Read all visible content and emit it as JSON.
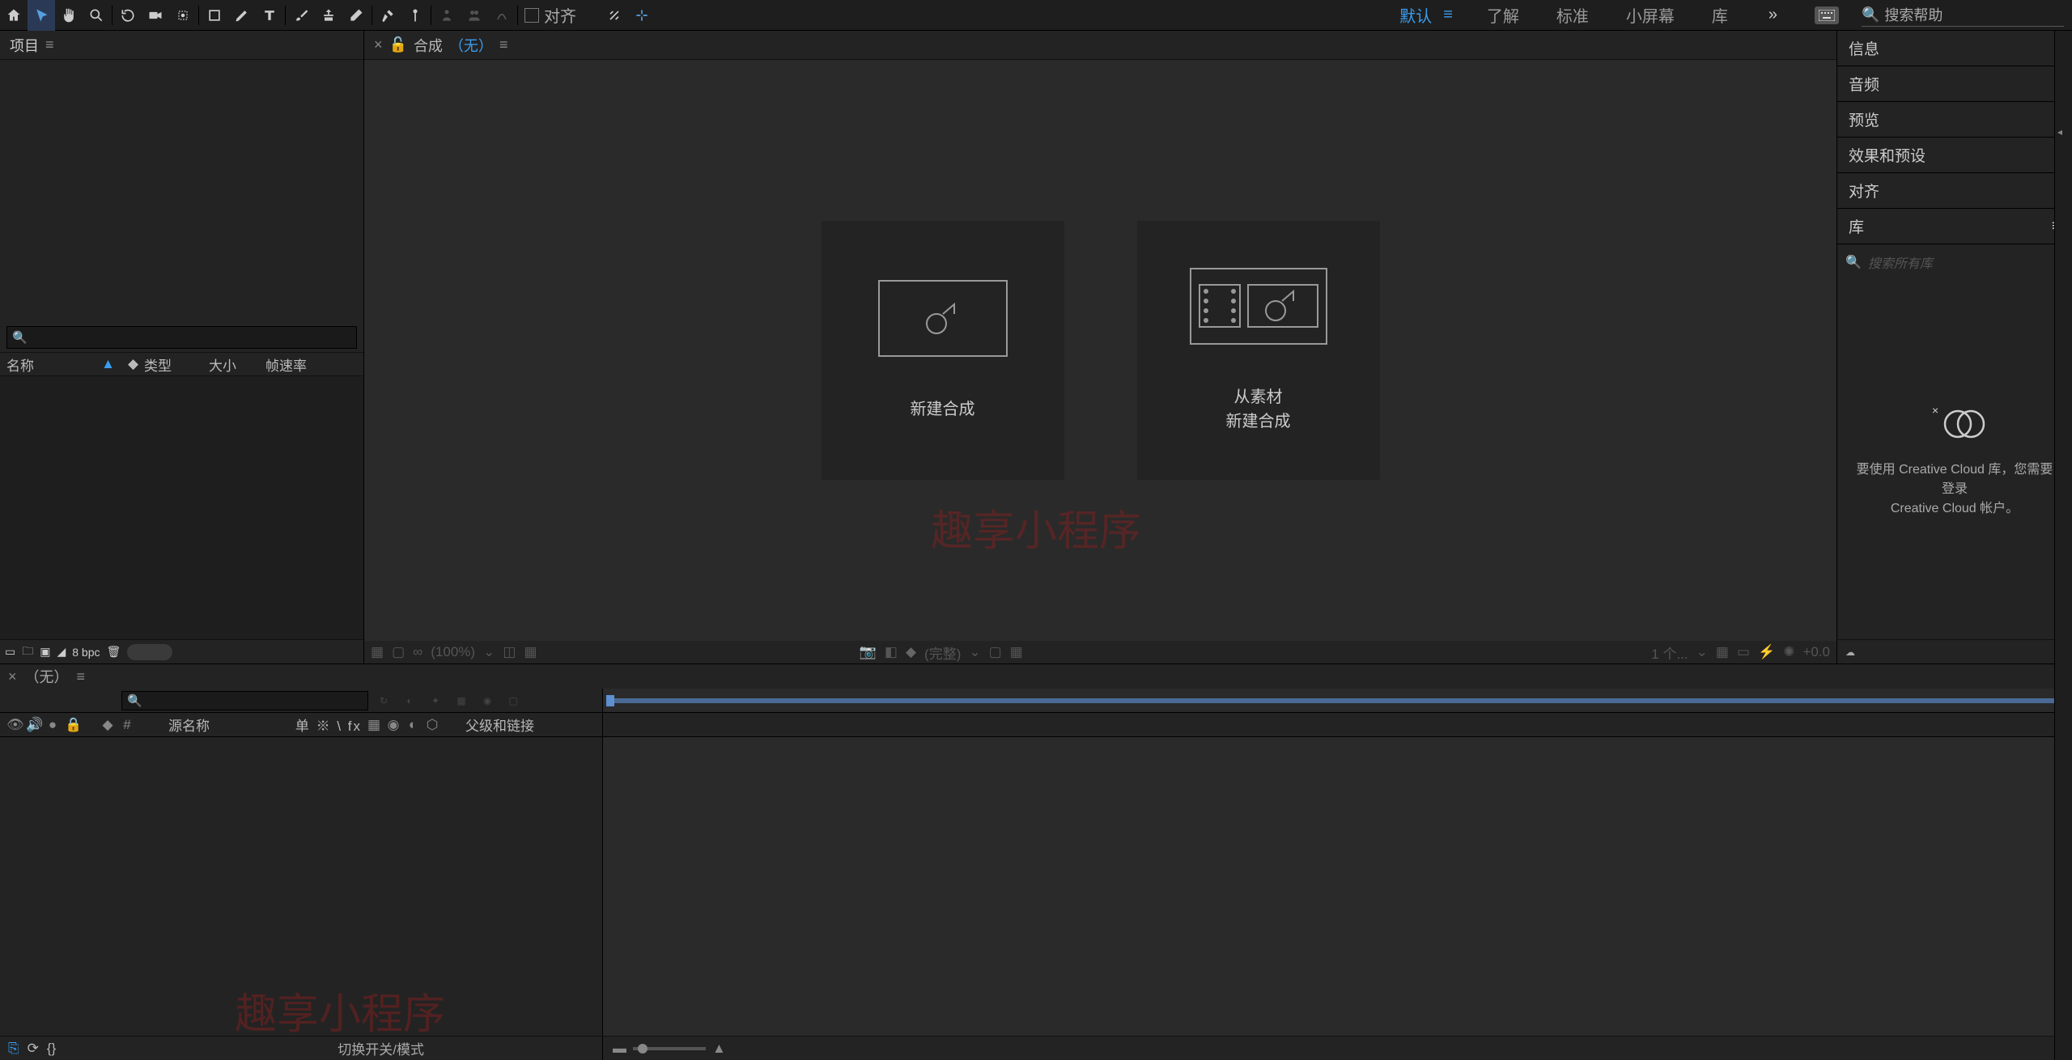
{
  "toolbar": {
    "align_label": "对齐"
  },
  "workspaces": {
    "tabs": [
      "默认",
      "了解",
      "标准",
      "小屏幕",
      "库"
    ],
    "active_index": 0,
    "more_glyph": "»"
  },
  "search": {
    "placeholder": "搜索帮助"
  },
  "project": {
    "tab": "项目",
    "search_icon": "🔍",
    "headers": {
      "name": "名称",
      "type": "类型",
      "size": "大小",
      "fps": "帧速率"
    },
    "footer": {
      "bpc": "8 bpc"
    }
  },
  "composition": {
    "tab_label": "合成",
    "none": "（无）",
    "card_new": "新建合成",
    "card_from_footage_l1": "从素材",
    "card_from_footage_l2": "新建合成",
    "tb": {
      "zoom": "(100%)",
      "full": "(完整)",
      "views": "1 个...",
      "exposure": "+0.0"
    }
  },
  "watermark": "趣享小程序",
  "right_panels": {
    "rows": [
      "信息",
      "音频",
      "预览",
      "效果和预设",
      "对齐",
      "库"
    ],
    "lib_search_placeholder": "搜索所有库",
    "cc_msg_l1": "要使用 Creative Cloud 库，您需要登录",
    "cc_msg_l2": "Creative Cloud 帐户。"
  },
  "timeline": {
    "tab_none": "（无）",
    "hdr": {
      "num": "#",
      "source_name": "源名称",
      "switches": "单 ※ \\ fx",
      "parent": "父级和链接"
    },
    "footer_center": "切换开关/模式"
  }
}
